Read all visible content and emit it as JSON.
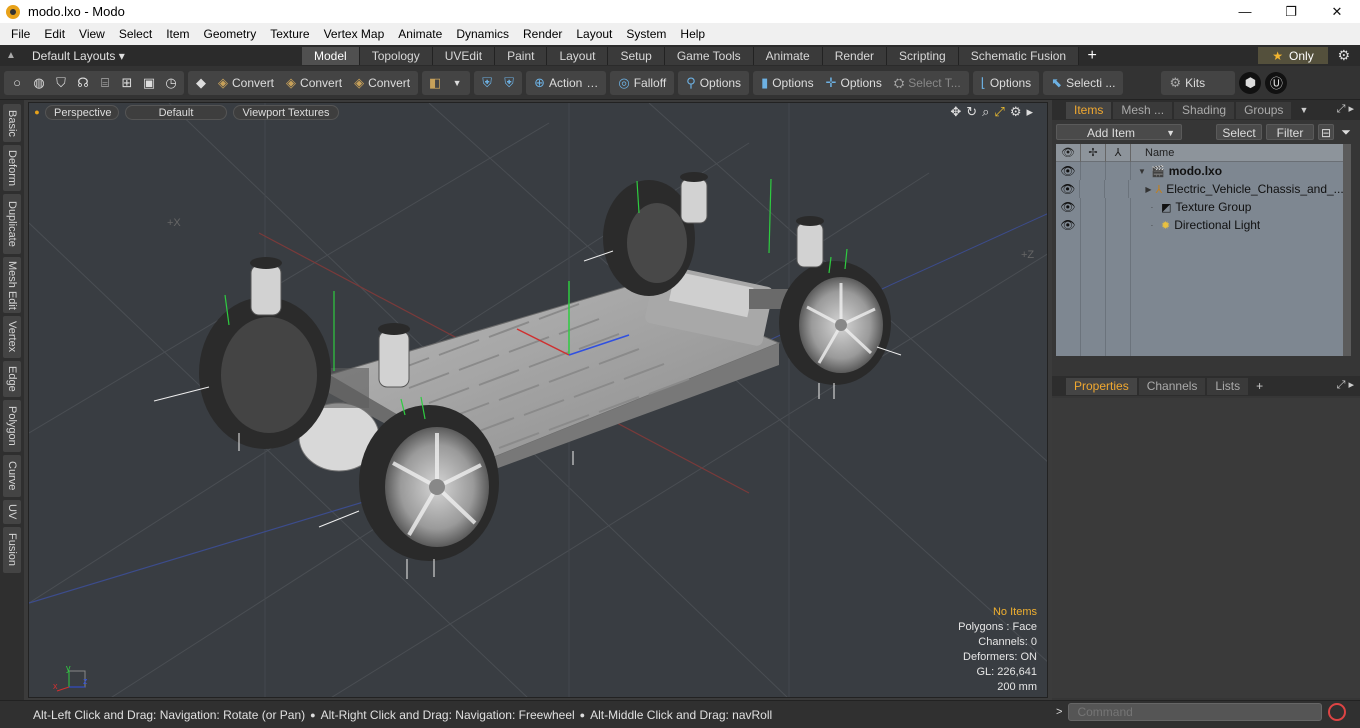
{
  "window": {
    "title": "modo.lxo - Modo",
    "minimize": "—",
    "maximize": "❐",
    "close": "✕"
  },
  "menu": [
    "File",
    "Edit",
    "View",
    "Select",
    "Item",
    "Geometry",
    "Texture",
    "Vertex Map",
    "Animate",
    "Dynamics",
    "Render",
    "Layout",
    "System",
    "Help"
  ],
  "layoutbar": {
    "layout_select": "Default Layouts ▾",
    "tabs": [
      "Model",
      "Topology",
      "UVEdit",
      "Paint",
      "Layout",
      "Setup",
      "Game Tools",
      "Animate",
      "Render",
      "Scripting",
      "Schematic Fusion"
    ],
    "active_tab": "Model",
    "add": "+",
    "only_label": "Only",
    "star": "★",
    "gear": "⚙"
  },
  "toolbar": {
    "convert1": "Convert",
    "convert2": "Convert",
    "convert3": "Convert",
    "action": "Action",
    "falloff": "Falloff",
    "options1": "Options",
    "options2": "Options",
    "options3": "Options",
    "select_t": "Select T...",
    "options4": "Options",
    "selecti": "Selecti ...",
    "kits": "Kits"
  },
  "left_tabs": [
    "Basic",
    "Deform",
    "Duplicate",
    "Mesh Edit",
    "Vertex",
    "Edge",
    "Polygon",
    "Curve",
    "UV",
    "Fusion"
  ],
  "viewport": {
    "view_mode": "Perspective",
    "shading": "Default",
    "textures": "Viewport Textures",
    "axis_x": "+X",
    "axis_z": "+Z",
    "info": {
      "no_items": "No Items",
      "polygons": "Polygons : Face",
      "channels": "Channels: 0",
      "deformers": "Deformers: ON",
      "gl": "GL: 226,641",
      "scale": "200 mm"
    }
  },
  "items_panel": {
    "tabs": [
      "Items",
      "Mesh ...",
      "Shading",
      "Groups"
    ],
    "active_tab": "Items",
    "add_item": "Add Item",
    "select": "Select",
    "filter": "Filter",
    "name_header": "Name",
    "rows": [
      {
        "name": "modo.lxo",
        "icon": "scene-icon"
      },
      {
        "name": "Electric_Vehicle_Chassis_and_...",
        "icon": "mesh-icon"
      },
      {
        "name": "Texture Group",
        "icon": "texture-group-icon"
      },
      {
        "name": "Directional Light",
        "icon": "light-icon"
      }
    ]
  },
  "props_panel": {
    "tabs": [
      "Properties",
      "Channels",
      "Lists"
    ],
    "active_tab": "Properties",
    "add": "+"
  },
  "statusbar": {
    "hint1": "Alt-Left Click and Drag: Navigation: Rotate (or Pan)",
    "hint2": "Alt-Right Click and Drag: Navigation: Freewheel",
    "hint3": "Alt-Middle Click and Drag: navRoll",
    "command_placeholder": "Command"
  }
}
